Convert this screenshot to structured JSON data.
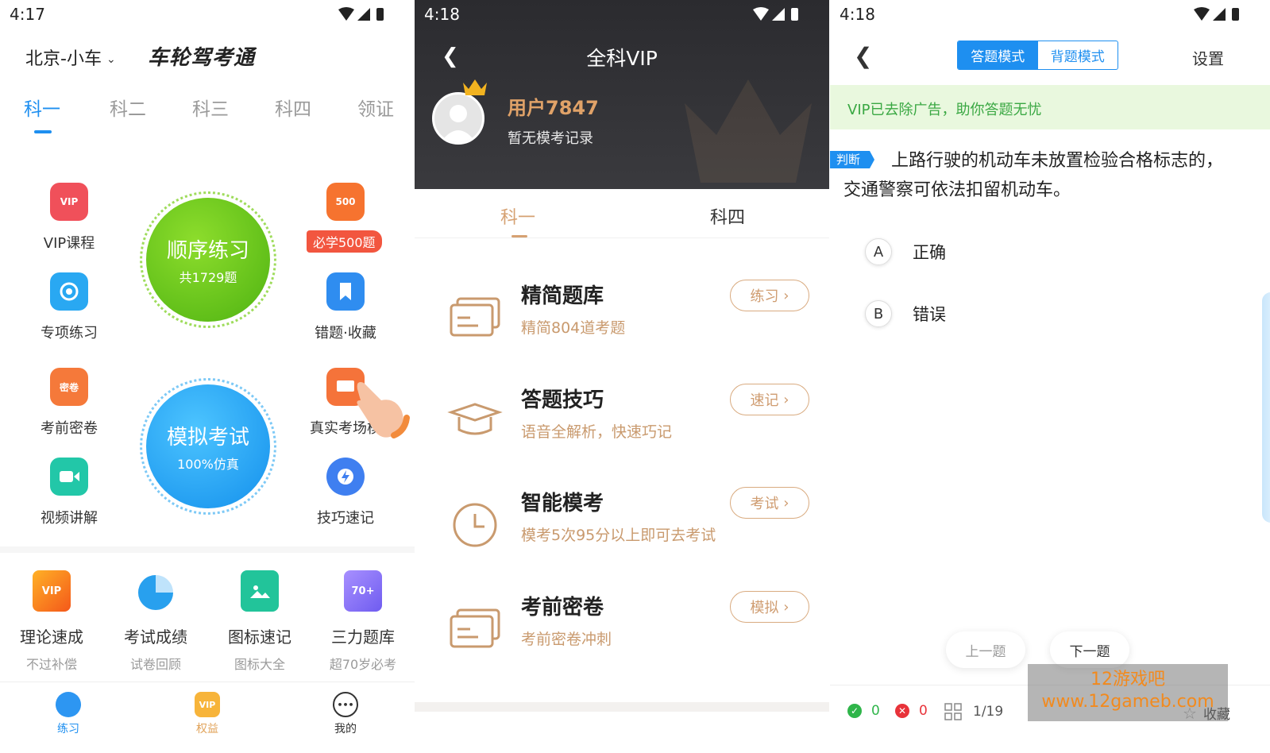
{
  "screen1": {
    "status_time": "4:17",
    "city": "北京-小车",
    "brand": "车轮驾考通",
    "tabs": [
      "科一",
      "科二",
      "科三",
      "科四",
      "领证"
    ],
    "grid": [
      {
        "label": "VIP课程",
        "icon": "vip-course-icon",
        "icon_text": "VIP"
      },
      {
        "label": "专项练习",
        "icon": "target-icon",
        "icon_text": ""
      },
      {
        "label": "考前密卷",
        "icon": "exam-paper-icon",
        "icon_text": "密卷"
      },
      {
        "label": "视频讲解",
        "icon": "video-icon",
        "icon_text": ""
      },
      {
        "label": "错题·收藏",
        "icon": "bookmark-icon",
        "icon_text": ""
      },
      {
        "label": "真实考场模",
        "icon": "real-exam-icon",
        "icon_text": ""
      },
      {
        "label": "技巧速记",
        "icon": "tips-icon",
        "icon_text": ""
      }
    ],
    "must_learn": {
      "icon_text": "500",
      "badge": "必学500题"
    },
    "seq_practice": {
      "title": "顺序练习",
      "sub": "共1729题"
    },
    "mock_exam": {
      "title": "模拟考试",
      "sub": "100%仿真"
    },
    "quick_tools": [
      {
        "title": "理论速成",
        "sub": "不过补偿",
        "icon_text": "VIP"
      },
      {
        "title": "考试成绩",
        "sub": "试卷回顾",
        "icon_text": ""
      },
      {
        "title": "图标速记",
        "sub": "图标大全",
        "icon_text": ""
      },
      {
        "title": "三力题库",
        "sub": "超70岁必考",
        "icon_text": "70+"
      }
    ],
    "bottom_nav": [
      {
        "label": "练习",
        "icon_text": ""
      },
      {
        "label": "权益",
        "icon_text": "VIP"
      },
      {
        "label": "我的",
        "icon_text": "•••"
      }
    ]
  },
  "screen2": {
    "status_time": "4:18",
    "title": "全科VIP",
    "user_name": "用户7847",
    "user_record": "暂无模考记录",
    "tabs": [
      "科一",
      "科四"
    ],
    "rows": [
      {
        "title": "精简题库",
        "sub": "精简804道考题",
        "button": "练习"
      },
      {
        "title": "答题技巧",
        "sub": "语音全解析，快速巧记",
        "button": "速记"
      },
      {
        "title": "智能模考",
        "sub": "模考5次95分以上即可去考试",
        "button": "考试"
      },
      {
        "title": "考前密卷",
        "sub": "考前密卷冲刺",
        "button": "模拟"
      }
    ]
  },
  "screen3": {
    "status_time": "4:18",
    "mode_answer": "答题模式",
    "mode_recite": "背题模式",
    "settings": "设置",
    "notice": "VIP已去除广告，助你答题无忧",
    "question_tag": "判断",
    "question": "上路行驶的机动车未放置检验合格标志的，交通警察可依法扣留机动车。",
    "options": [
      {
        "key": "A",
        "text": "正确"
      },
      {
        "key": "B",
        "text": "错误"
      }
    ],
    "prev": "上一题",
    "next": "下一题",
    "correct_count": "0",
    "wrong_count": "0",
    "progress": "1/19",
    "favorite": "收藏",
    "watermark_line1": "12游戏吧",
    "watermark_line2": "www.12gameb.com"
  },
  "colors": {
    "primary_blue": "#1e8ff0",
    "green_circle": "#6cc51f",
    "gold": "#d6a172",
    "notice_green": "#3aa843"
  }
}
